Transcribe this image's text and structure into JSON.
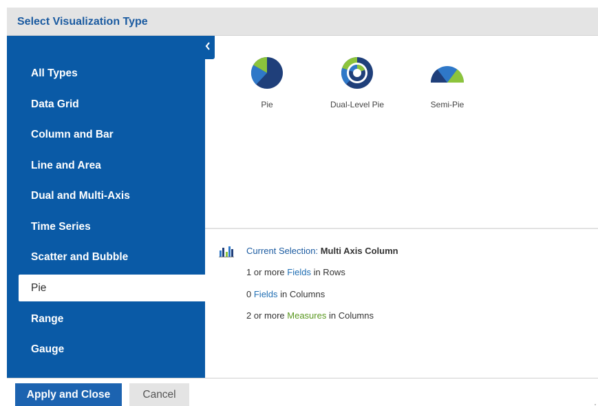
{
  "dialog": {
    "title": "Select Visualization Type"
  },
  "sidebar": {
    "items": [
      {
        "label": "All Types"
      },
      {
        "label": "Data Grid"
      },
      {
        "label": "Column and Bar"
      },
      {
        "label": "Line and Area"
      },
      {
        "label": "Dual and Multi-Axis"
      },
      {
        "label": "Time Series"
      },
      {
        "label": "Scatter and Bubble"
      },
      {
        "label": "Pie",
        "selected": true
      },
      {
        "label": "Range"
      },
      {
        "label": "Gauge"
      }
    ],
    "collapse_icon": "chevron-left-icon",
    "background_color": "#0a5aa6"
  },
  "gallery": {
    "options": [
      {
        "label": "Pie",
        "icon": "pie-chart-icon"
      },
      {
        "label": "Dual-Level Pie",
        "icon": "dual-level-pie-icon"
      },
      {
        "label": "Semi-Pie",
        "icon": "semi-pie-icon"
      }
    ]
  },
  "current_selection": {
    "label": "Current Selection:",
    "value": "Multi Axis Column",
    "icon": "multi-axis-column-icon",
    "requirements": [
      {
        "prefix": "1 or more",
        "keyword": "Fields",
        "suffix": "in Rows",
        "keyword_color": "#1f6eb3"
      },
      {
        "prefix": "0",
        "keyword": "Fields",
        "suffix": "in Columns",
        "keyword_color": "#1f6eb3"
      },
      {
        "prefix": "2 or more",
        "keyword": "Measures",
        "suffix": "in Columns",
        "keyword_color": "#5a9820"
      }
    ]
  },
  "footer": {
    "apply_label": "Apply and Close",
    "cancel_label": "Cancel"
  },
  "colors": {
    "accent": "#1c63b0",
    "chart_dark": "#1f3f7a",
    "chart_mid": "#2f78c8",
    "chart_green": "#8cc43c"
  }
}
